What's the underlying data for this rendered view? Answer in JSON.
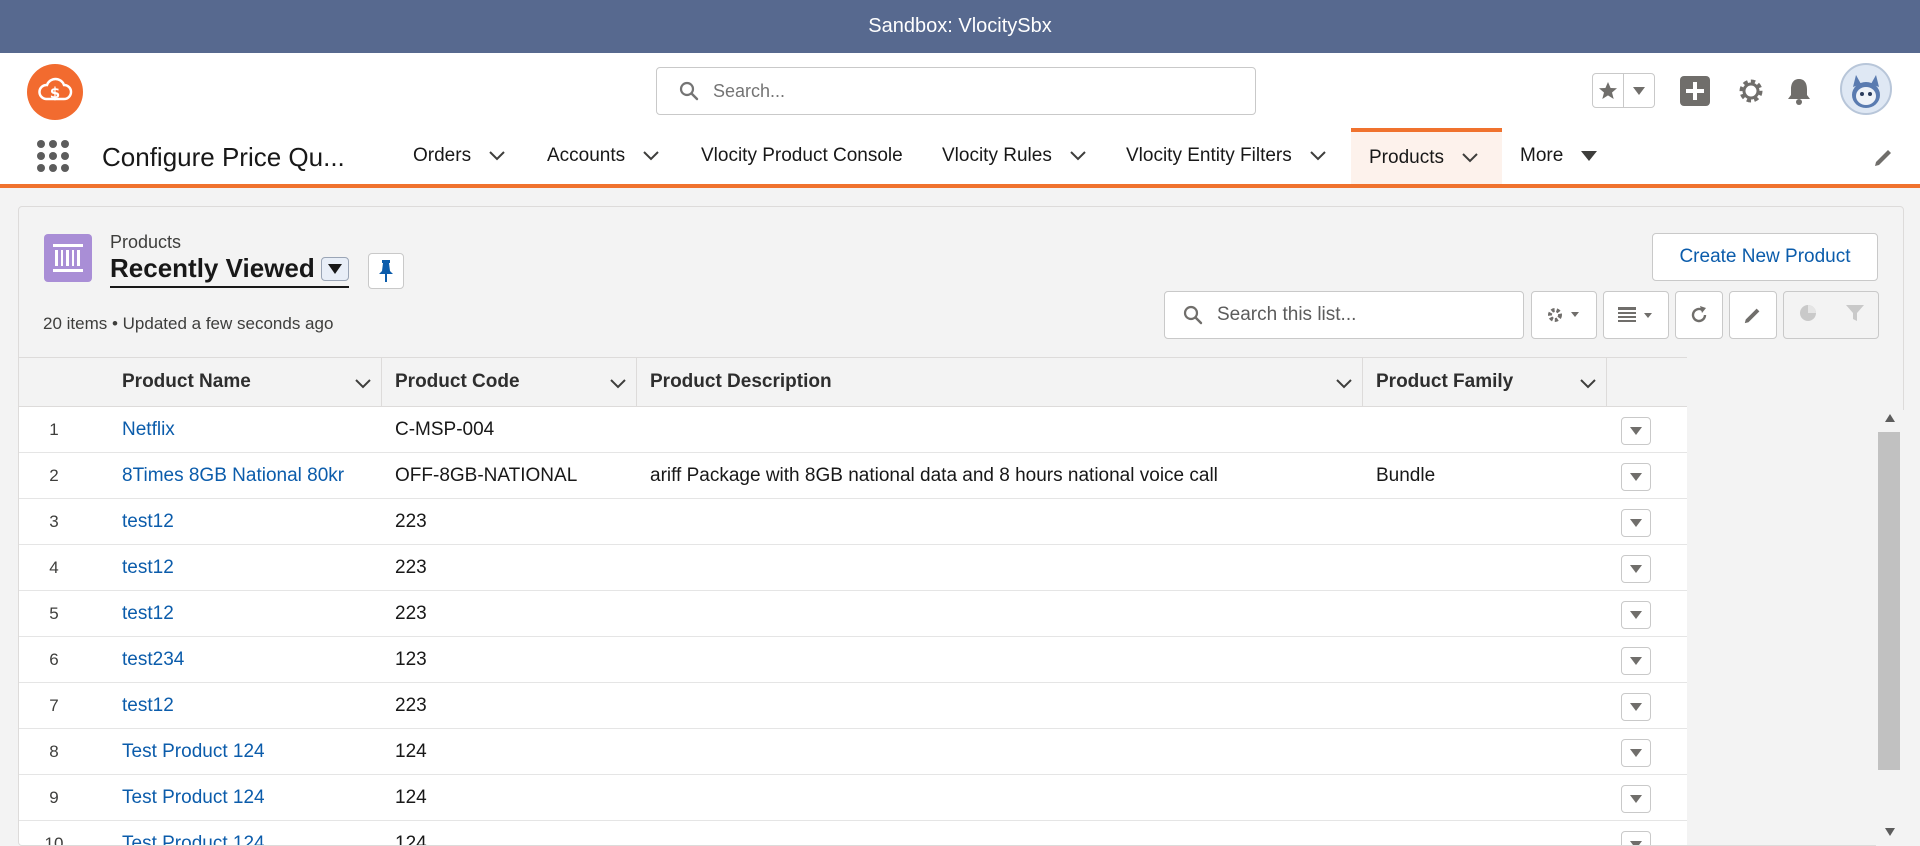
{
  "banner": {
    "text": "Sandbox: VlocitySbx"
  },
  "header": {
    "search_placeholder": "Search..."
  },
  "app": {
    "name": "Configure Price Qu...",
    "nav": [
      {
        "label": "Orders"
      },
      {
        "label": "Accounts"
      },
      {
        "label": "Vlocity Product Console"
      },
      {
        "label": "Vlocity Rules"
      },
      {
        "label": "Vlocity Entity Filters"
      },
      {
        "label": "Products"
      },
      {
        "label": "More"
      }
    ]
  },
  "list": {
    "object_label": "Products",
    "view_name": "Recently Viewed",
    "meta": "20 items • Updated a few seconds ago",
    "create_button": "Create New Product",
    "search_placeholder": "Search this list...",
    "columns": [
      "Product Name",
      "Product Code",
      "Product Description",
      "Product Family"
    ],
    "rows": [
      {
        "num": "1",
        "name": "Netflix",
        "code": "C-MSP-004",
        "desc": "",
        "family": ""
      },
      {
        "num": "2",
        "name": "8Times 8GB National 80kr",
        "code": "OFF-8GB-NATIONAL",
        "desc": "ariff Package with 8GB national data and 8 hours national voice call",
        "family": "Bundle"
      },
      {
        "num": "3",
        "name": "test12",
        "code": "223",
        "desc": "",
        "family": ""
      },
      {
        "num": "4",
        "name": "test12",
        "code": "223",
        "desc": "",
        "family": ""
      },
      {
        "num": "5",
        "name": "test12",
        "code": "223",
        "desc": "",
        "family": ""
      },
      {
        "num": "6",
        "name": "test234",
        "code": "123",
        "desc": "",
        "family": ""
      },
      {
        "num": "7",
        "name": "test12",
        "code": "223",
        "desc": "",
        "family": ""
      },
      {
        "num": "8",
        "name": "Test Product 124",
        "code": "124",
        "desc": "",
        "family": ""
      },
      {
        "num": "9",
        "name": "Test Product 124",
        "code": "124",
        "desc": "",
        "family": ""
      },
      {
        "num": "10",
        "name": "Test Product 124",
        "code": "124",
        "desc": "",
        "family": ""
      }
    ]
  },
  "colors": {
    "banner": "#57698f",
    "accent": "#f0722e",
    "link": "#0b5cab",
    "object_icon": "#a98ed6"
  }
}
